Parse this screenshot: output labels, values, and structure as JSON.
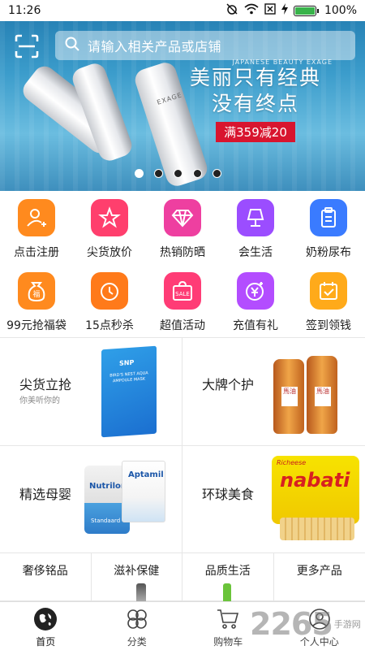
{
  "status": {
    "time": "11:26",
    "battery": "100%",
    "battery_level": 1.0
  },
  "search": {
    "placeholder": "请输入相关产品或店铺"
  },
  "banner": {
    "tagline_top": "JAPANESE BEAUTY EXAGE",
    "headline_1": "美丽只有经典",
    "headline_2": "没有终点",
    "promo_tag": "满359减20",
    "product_label": "EXAGE",
    "slides": 5,
    "active_slide": 1
  },
  "menu": [
    {
      "label": "点击注册",
      "icon": "user-plus-icon",
      "color": "#ff8a1e"
    },
    {
      "label": "尖货放价",
      "icon": "star-icon",
      "color": "#ff3f6d"
    },
    {
      "label": "热销防晒",
      "icon": "diamond-icon",
      "color": "#ee3fa0"
    },
    {
      "label": "会生活",
      "icon": "lamp-icon",
      "color": "#9b4dff"
    },
    {
      "label": "奶粉尿布",
      "icon": "clipboard-icon",
      "color": "#3a7bff"
    },
    {
      "label": "99元抢福袋",
      "icon": "lucky-bag-icon",
      "color": "#ff8a1e"
    },
    {
      "label": "15点秒杀",
      "icon": "timer-icon",
      "color": "#ff7a1a"
    },
    {
      "label": "超值活动",
      "icon": "sale-bag-icon",
      "color": "#ff3c76"
    },
    {
      "label": "充值有礼",
      "icon": "yen-coin-icon",
      "color": "#b34dff"
    },
    {
      "label": "签到领钱",
      "icon": "calendar-check-icon",
      "color": "#ffaa1a"
    }
  ],
  "tiles": {
    "t1": {
      "title": "尖货立抢",
      "subtitle": "你美听你的",
      "product_text": "BIRD'S NEST AQUA AMPOULE MASK",
      "brand": "SNP"
    },
    "t2": {
      "title": "大牌个护",
      "product_text": "馬油"
    },
    "t3": {
      "title": "精选母婴",
      "product_text": "Nutrilon",
      "product_text_2": "Aptamil",
      "product_text_3": "Standaard"
    },
    "t4": {
      "title": "环球美食",
      "product_text": "nabati",
      "brand": "Richeese"
    }
  },
  "categories": [
    "奢侈铭品",
    "滋补保健",
    "品质生活",
    "更多产品"
  ],
  "nav": [
    {
      "label": "首页",
      "icon": "globe-home-icon",
      "active": true
    },
    {
      "label": "分类",
      "icon": "clover-icon",
      "active": false
    },
    {
      "label": "购物车",
      "icon": "cart-icon",
      "active": false
    },
    {
      "label": "个人中心",
      "icon": "user-circle-icon",
      "active": false
    }
  ],
  "watermark": {
    "number": "2265",
    "text": "手游网"
  }
}
